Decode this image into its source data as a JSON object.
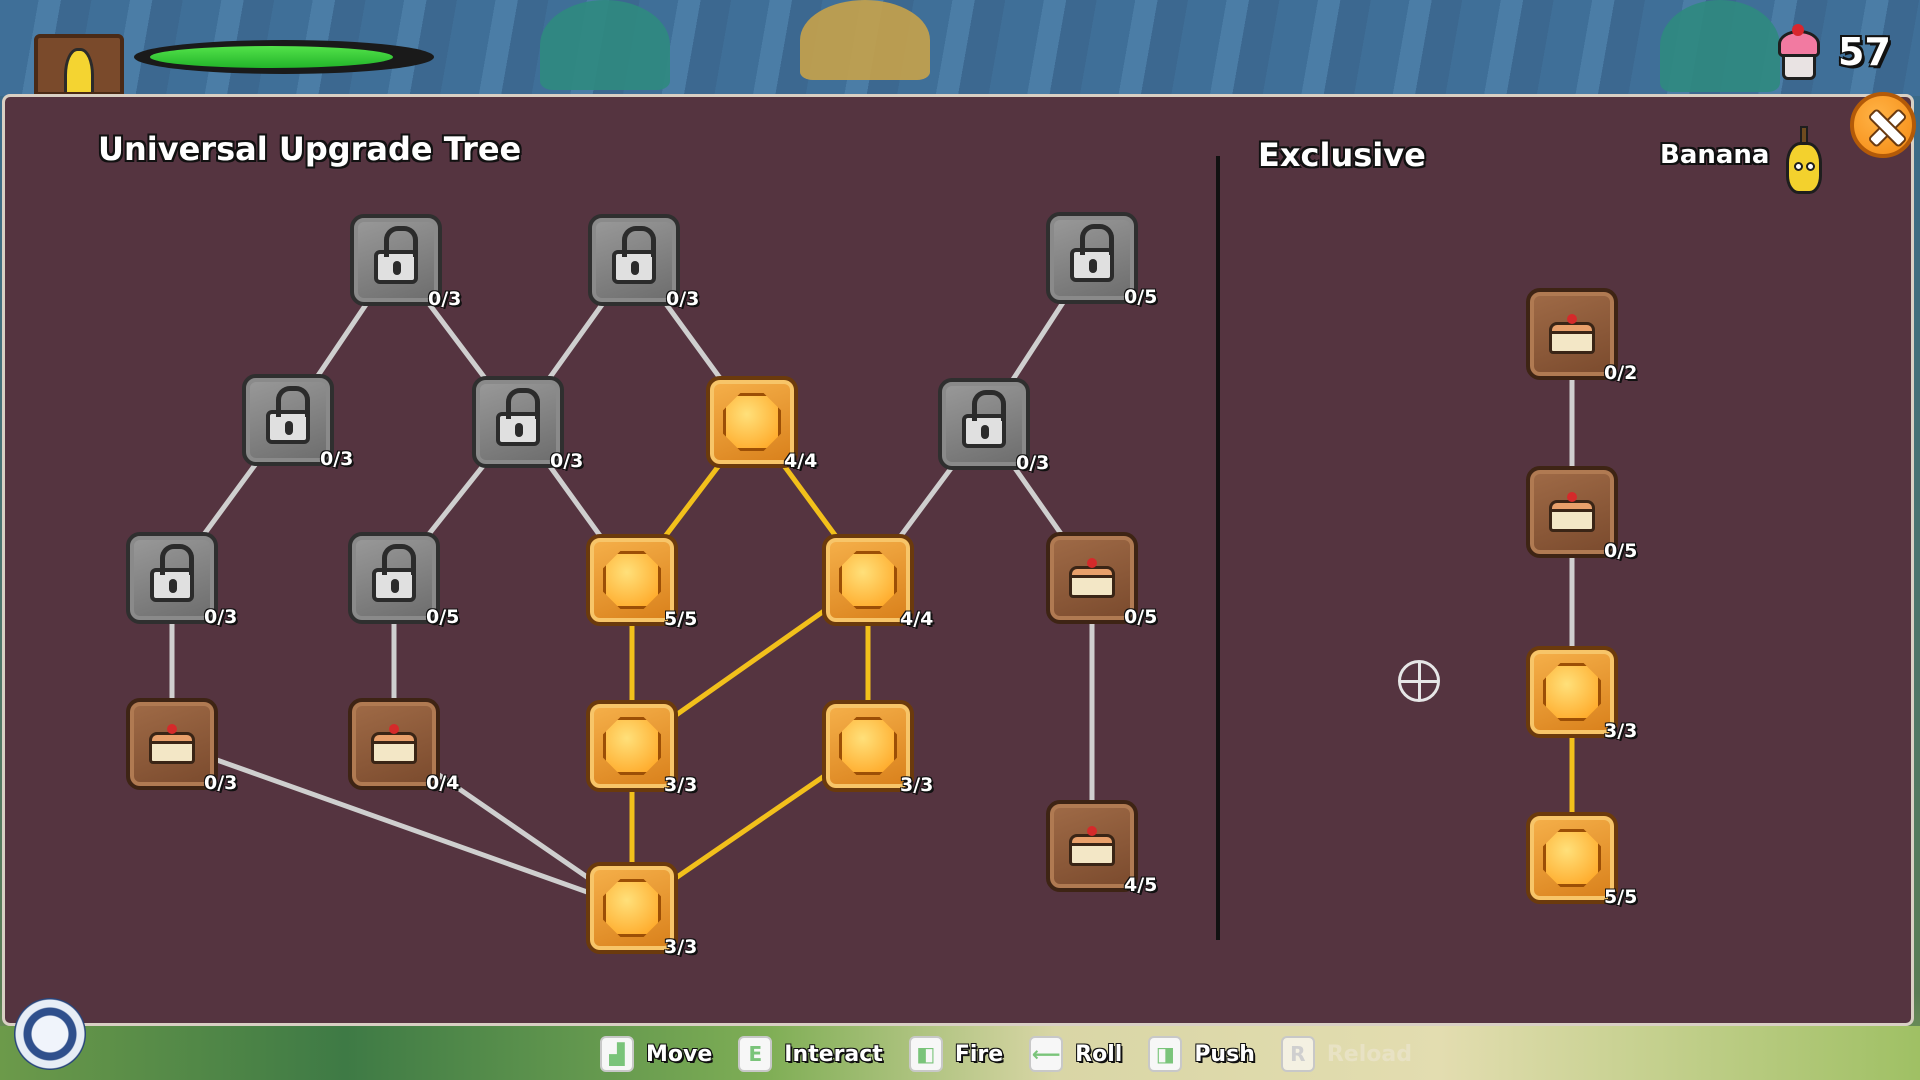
{
  "hud": {
    "currency_value": "57",
    "health_fraction": 0.9,
    "currency_icon": "cupcake-icon"
  },
  "panel": {
    "universal_title": "Universal Upgrade Tree",
    "exclusive_title": "Exclusive",
    "character_name": "Banana"
  },
  "universal_nodes": [
    {
      "id": "u1",
      "type": "locked",
      "count": "0/3"
    },
    {
      "id": "u2",
      "type": "locked",
      "count": "0/3"
    },
    {
      "id": "u3",
      "type": "locked",
      "count": "0/5"
    },
    {
      "id": "u4",
      "type": "locked",
      "count": "0/3"
    },
    {
      "id": "u5",
      "type": "locked",
      "count": "0/3"
    },
    {
      "id": "u6",
      "type": "gem",
      "count": "4/4"
    },
    {
      "id": "u7",
      "type": "locked",
      "count": "0/3"
    },
    {
      "id": "u8",
      "type": "locked",
      "count": "0/3"
    },
    {
      "id": "u9",
      "type": "locked",
      "count": "0/5"
    },
    {
      "id": "u10",
      "type": "gem",
      "count": "5/5"
    },
    {
      "id": "u11",
      "type": "gem",
      "count": "4/4"
    },
    {
      "id": "u12",
      "type": "cake",
      "count": "0/5"
    },
    {
      "id": "u13",
      "type": "cake",
      "count": "0/3"
    },
    {
      "id": "u14",
      "type": "cake",
      "count": "0/4"
    },
    {
      "id": "u15",
      "type": "gem",
      "count": "3/3"
    },
    {
      "id": "u16",
      "type": "gem",
      "count": "3/3"
    },
    {
      "id": "u17",
      "type": "cake",
      "count": "4/5"
    },
    {
      "id": "u18",
      "type": "gem",
      "count": "3/3"
    }
  ],
  "exclusive_nodes": [
    {
      "id": "e1",
      "type": "cake",
      "count": "0/2"
    },
    {
      "id": "e2",
      "type": "cake",
      "count": "0/5"
    },
    {
      "id": "e3",
      "type": "gem",
      "count": "3/3"
    },
    {
      "id": "e4",
      "type": "gem",
      "count": "5/5"
    }
  ],
  "controls": [
    {
      "key": "move-keys",
      "glyph": "▟",
      "label": "Move",
      "dim": false
    },
    {
      "key": "E",
      "glyph": "E",
      "label": "Interact",
      "dim": false
    },
    {
      "key": "left-mouse",
      "glyph": "◧",
      "label": "Fire",
      "dim": false
    },
    {
      "key": "shift",
      "glyph": "⟵",
      "label": "Roll",
      "dim": false
    },
    {
      "key": "right-mouse",
      "glyph": "◨",
      "label": "Push",
      "dim": false
    },
    {
      "key": "R",
      "glyph": "R",
      "label": "Reload",
      "dim": true
    }
  ],
  "colors": {
    "panel_bg": "#553440",
    "active_edge": "#f2c01b",
    "inactive_edge": "#cfcfcf",
    "accent_orange": "#f58a12"
  }
}
